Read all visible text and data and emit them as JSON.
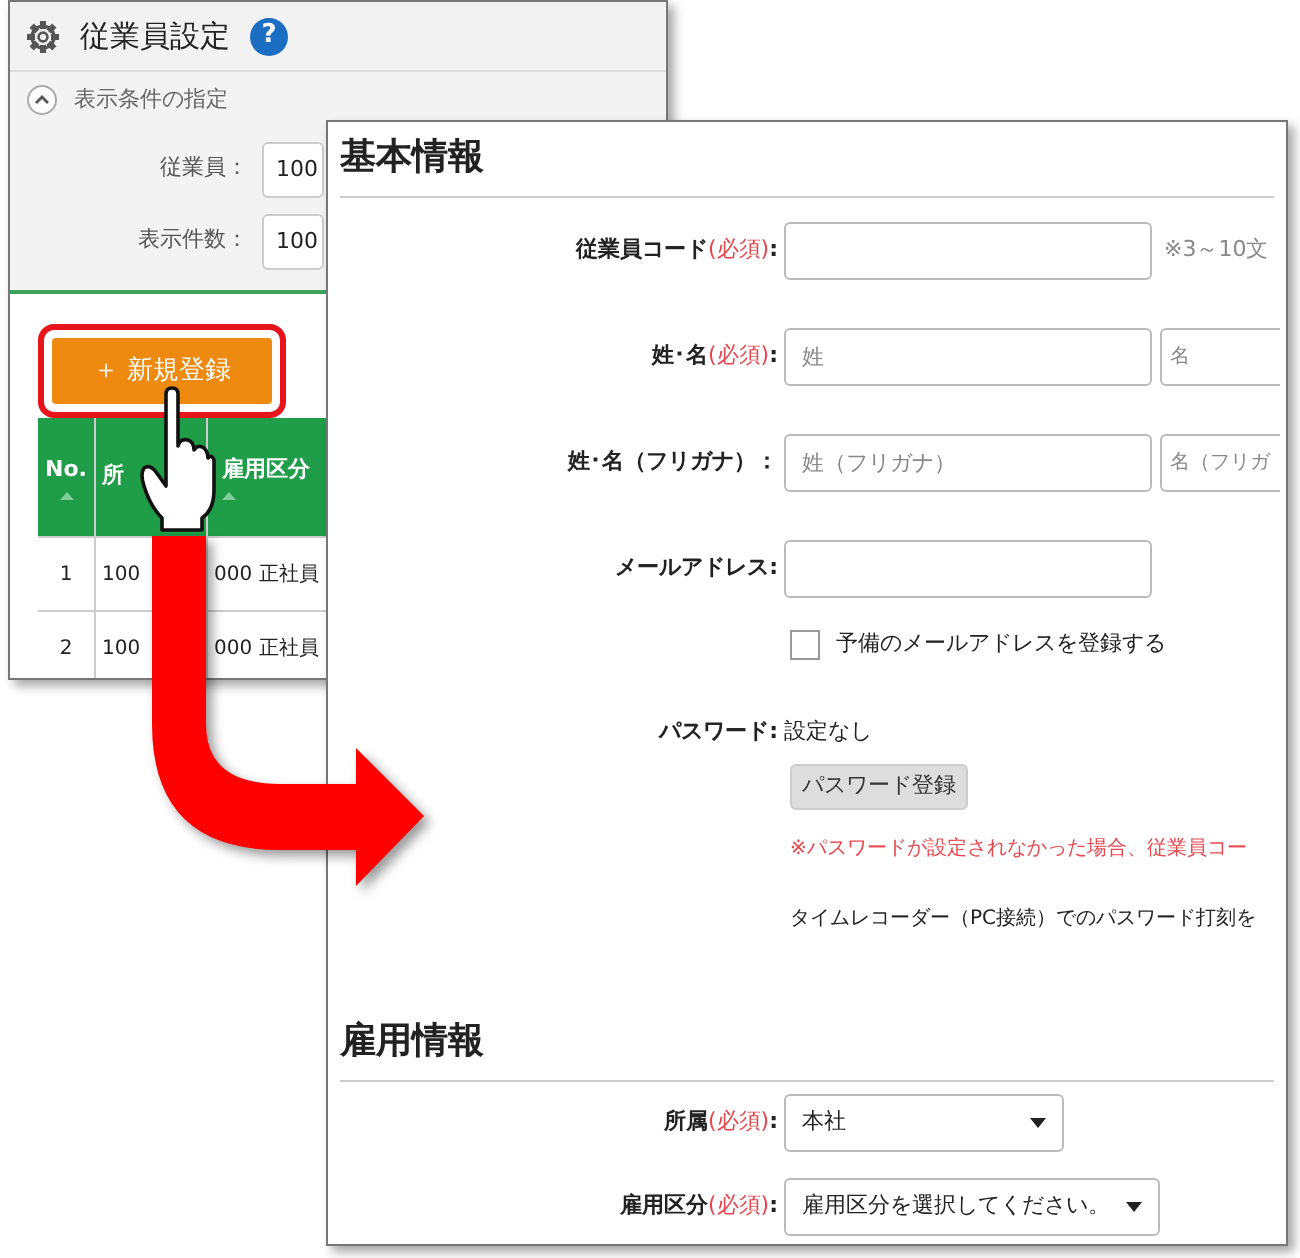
{
  "back_window": {
    "title": "従業員設定",
    "help": "?",
    "filter_panel": {
      "heading": "表示条件の指定",
      "expanded": true,
      "fields": [
        {
          "label": "従業員：",
          "value": "100"
        },
        {
          "label": "表示件数：",
          "value": "100"
        }
      ]
    },
    "new_button": {
      "label": "＋ 新規登録",
      "highlighted": true
    },
    "table": {
      "columns": [
        "No.",
        "所",
        "雇用区分"
      ],
      "rows": [
        [
          "1",
          "100",
          "000 正社員"
        ],
        [
          "2",
          "100",
          "000 正社員"
        ]
      ]
    }
  },
  "front_window": {
    "sections": [
      {
        "heading": "基本情報",
        "rows": [
          {
            "kind": "inputs",
            "label": "従業員コード",
            "required": "(必須)",
            "colon": ":",
            "inputs": [
              {
                "kind": "text"
              }
            ],
            "note": "※3～10文"
          },
          {
            "kind": "inputs",
            "label": "姓･名",
            "required": "(必須)",
            "colon": ":",
            "inputs": [
              {
                "kind": "text",
                "placeholder": "姓"
              },
              {
                "kind": "text",
                "placeholder": "名"
              }
            ]
          },
          {
            "kind": "inputs",
            "label": "姓･名（フリガナ）",
            "colon": "：",
            "inputs": [
              {
                "kind": "text",
                "placeholder": "姓（フリガナ）"
              },
              {
                "kind": "text",
                "placeholder": "名（フリガ"
              }
            ]
          },
          {
            "kind": "inputs",
            "label": "メールアドレス",
            "colon": ":",
            "inputs": [
              {
                "kind": "text"
              }
            ]
          },
          {
            "kind": "checkbox",
            "label": "予備のメールアドレスを登録する",
            "checked": false
          },
          {
            "kind": "password",
            "label": "パスワード",
            "colon": ":",
            "value": "設定なし",
            "button": "パスワード登録",
            "warning": "※パスワードが設定されなかった場合、従業員コー",
            "note": "タイムレコーダー（PC接続）でのパスワード打刻を"
          }
        ]
      },
      {
        "heading": "雇用情報",
        "rows": [
          {
            "kind": "select",
            "label": "所属",
            "required": "(必須)",
            "colon": ":",
            "value": "本社"
          },
          {
            "kind": "select",
            "label": "雇用区分",
            "required": "(必須)",
            "colon": ":",
            "value": "雇用区分を選択してください。"
          }
        ]
      }
    ]
  }
}
